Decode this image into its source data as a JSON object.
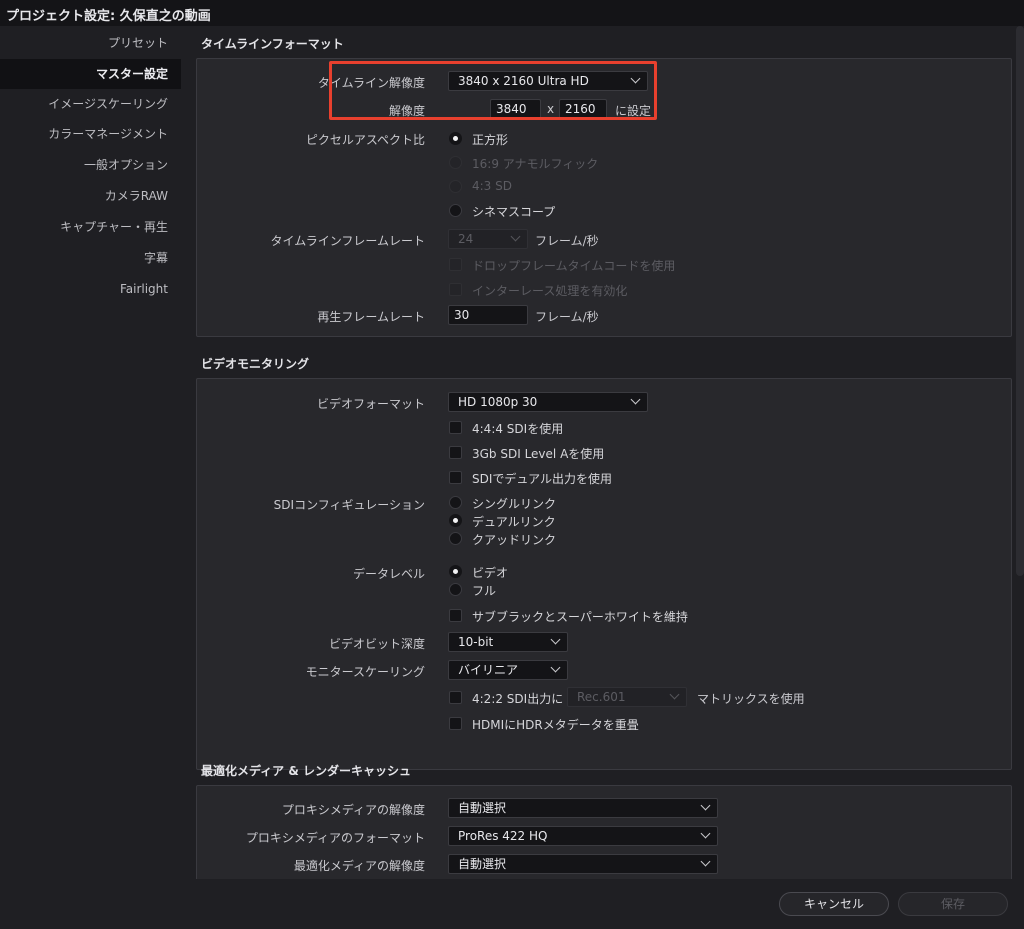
{
  "window": {
    "title": "プロジェクト設定: 久保直之の動画"
  },
  "sidebar": {
    "items": [
      {
        "label": "プリセット"
      },
      {
        "label": "マスター設定"
      },
      {
        "label": "イメージスケーリング"
      },
      {
        "label": "カラーマネージメント"
      },
      {
        "label": "一般オプション"
      },
      {
        "label": "カメラRAW"
      },
      {
        "label": "キャプチャー・再生"
      },
      {
        "label": "字幕"
      },
      {
        "label": "Fairlight"
      }
    ],
    "active": "マスター設定"
  },
  "timeline_format": {
    "title": "タイムラインフォーマット",
    "resolution_label": "タイムライン解像度",
    "resolution_value": "3840 x 2160 Ultra HD",
    "custom_label": "解像度",
    "width": "3840",
    "x_sep": "x",
    "height": "2160",
    "set_label": "に設定",
    "pixel_aspect_label": "ピクセルアスペクト比",
    "pixel_aspect_options": [
      {
        "label": "正方形",
        "selected": true,
        "disabled": false
      },
      {
        "label": "16:9 アナモルフィック",
        "selected": false,
        "disabled": true
      },
      {
        "label": "4:3 SD",
        "selected": false,
        "disabled": true
      },
      {
        "label": "シネマスコープ",
        "selected": false,
        "disabled": false
      }
    ],
    "frame_rate_label": "タイムラインフレームレート",
    "frame_rate_value": "24",
    "frame_rate_unit": "フレーム/秒",
    "drop_frame_label": "ドロップフレームタイムコードを使用",
    "interlace_label": "インターレース処理を有効化",
    "playback_rate_label": "再生フレームレート",
    "playback_rate_value": "30",
    "playback_rate_unit": "フレーム/秒"
  },
  "video_monitoring": {
    "title": "ビデオモニタリング",
    "format_label": "ビデオフォーマット",
    "format_value": "HD 1080p 30",
    "sdi444_label": "4:4:4 SDIを使用",
    "sdi3g_label": "3Gb SDI Level Aを使用",
    "sdi_dual_label": "SDIでデュアル出力を使用",
    "sdi_config_label": "SDIコンフィギュレーション",
    "sdi_config_options": [
      {
        "label": "シングルリンク",
        "selected": false
      },
      {
        "label": "デュアルリンク",
        "selected": true
      },
      {
        "label": "クアッドリンク",
        "selected": false
      }
    ],
    "data_level_label": "データレベル",
    "data_level_options": [
      {
        "label": "ビデオ",
        "selected": true
      },
      {
        "label": "フル",
        "selected": false
      }
    ],
    "retain_label": "サブブラックとスーパーホワイトを維持",
    "bit_depth_label": "ビデオビット深度",
    "bit_depth_value": "10-bit",
    "scaling_label": "モニタースケーリング",
    "scaling_value": "バイリニア",
    "sdi422_label": "4:2:2 SDI出力に",
    "matrix_value": "Rec.601",
    "matrix_suffix": "マトリックスを使用",
    "hdmi_hdr_label": "HDMIにHDRメタデータを重畳"
  },
  "optimized_media": {
    "title": "最適化メディア & レンダーキャッシュ",
    "proxy_res_label": "プロキシメディアの解像度",
    "proxy_res_value": "自動選択",
    "proxy_format_label": "プロキシメディアのフォーマット",
    "proxy_format_value": "ProRes 422 HQ",
    "opt_res_label": "最適化メディアの解像度",
    "opt_res_value": "自動選択"
  },
  "footer": {
    "cancel_label": "キャンセル",
    "save_label": "保存"
  },
  "colors": {
    "highlight": "#e8402e",
    "background": "#1f1f23",
    "panel": "#28282c"
  }
}
